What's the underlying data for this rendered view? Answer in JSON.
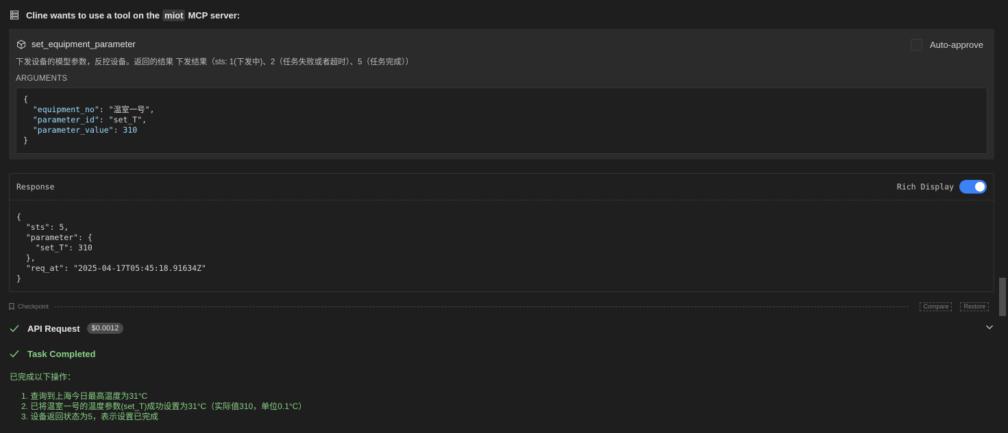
{
  "header": {
    "prefix": "Cline wants to use a tool on the",
    "server": "miot",
    "suffix": "MCP server:",
    "icon": "server-icon"
  },
  "tool": {
    "name": "set_equipment_parameter",
    "icon": "package-icon",
    "auto_approve_label": "Auto-approve",
    "auto_approve_checked": false,
    "description": "下发设备的模型参数，反控设备。返回的结果 下发结果（sts: 1(下发中)、2（任务失败或者超时）、5（任务完成））",
    "arguments_label": "ARGUMENTS",
    "arguments": {
      "equipment_no": "温室一号",
      "parameter_id": "set_T",
      "parameter_value": "310"
    }
  },
  "response": {
    "title": "Response",
    "rich_display_label": "Rich Display",
    "rich_display_on": true,
    "json": {
      "sts": "5",
      "set_T": "310",
      "req_at": "2025-04-17T05:45:18.91634Z"
    }
  },
  "checkpoint": {
    "label": "Checkpoint",
    "compare_label": "Compare",
    "restore_label": "Restore"
  },
  "api_request": {
    "label": "API Request",
    "cost": "$0.0012"
  },
  "task": {
    "label": "Task Completed",
    "intro": "已完成以下操作：",
    "steps": [
      "1. 查询到上海今日最高温度为31°C",
      "2. 已将温室一号的温度参数(set_T)成功设置为31°C（实际值310，单位0.1°C）",
      "3. 设备返回状态为5，表示设置已完成"
    ]
  },
  "colors": {
    "accent": "#3b82f6",
    "success": "#89d185",
    "background": "#1e1e1e"
  }
}
